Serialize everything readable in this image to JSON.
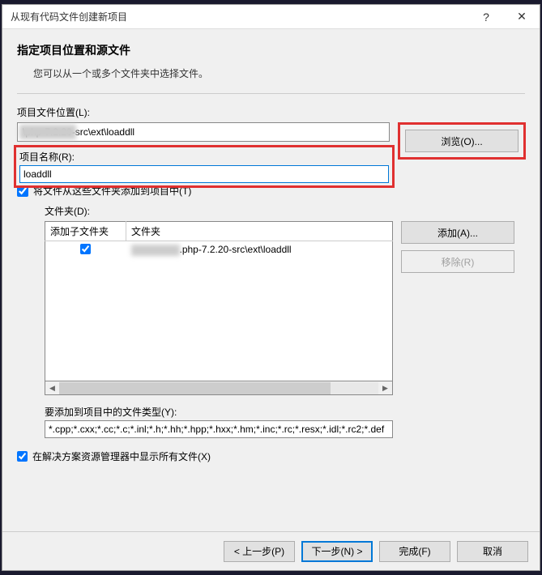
{
  "titlebar": {
    "title": "从现有代码文件创建新项目",
    "help": "?",
    "close": "✕"
  },
  "header": {
    "title": "指定项目位置和源文件",
    "subtitle": "您可以从一个或多个文件夹中选择文件。"
  },
  "location": {
    "label": "项目文件位置(L):",
    "value": "\\php-7.2.20-src\\ext\\loaddll",
    "browse": "浏览(O)..."
  },
  "name": {
    "label": "项目名称(R):",
    "value": "loaddll"
  },
  "add_folders": {
    "checkbox_label": "将文件从这些文件夹添加到项目中(T)",
    "folders_label": "文件夹(D):",
    "columns": [
      "添加子文件夹",
      "文件夹"
    ],
    "rows": [
      {
        "checked": true,
        "path": ".php-7.2.20-src\\ext\\loaddll"
      }
    ],
    "add_btn": "添加(A)...",
    "remove_btn": "移除(R)"
  },
  "file_types": {
    "label": "要添加到项目中的文件类型(Y):",
    "value": "*.cpp;*.cxx;*.cc;*.c;*.inl;*.h;*.hh;*.hpp;*.hxx;*.hm;*.inc;*.rc;*.resx;*.idl;*.rc2;*.def"
  },
  "show_all": {
    "label": "在解决方案资源管理器中显示所有文件(X)"
  },
  "footer": {
    "prev": "< 上一步(P)",
    "next": "下一步(N) >",
    "finish": "完成(F)",
    "cancel": "取消"
  }
}
